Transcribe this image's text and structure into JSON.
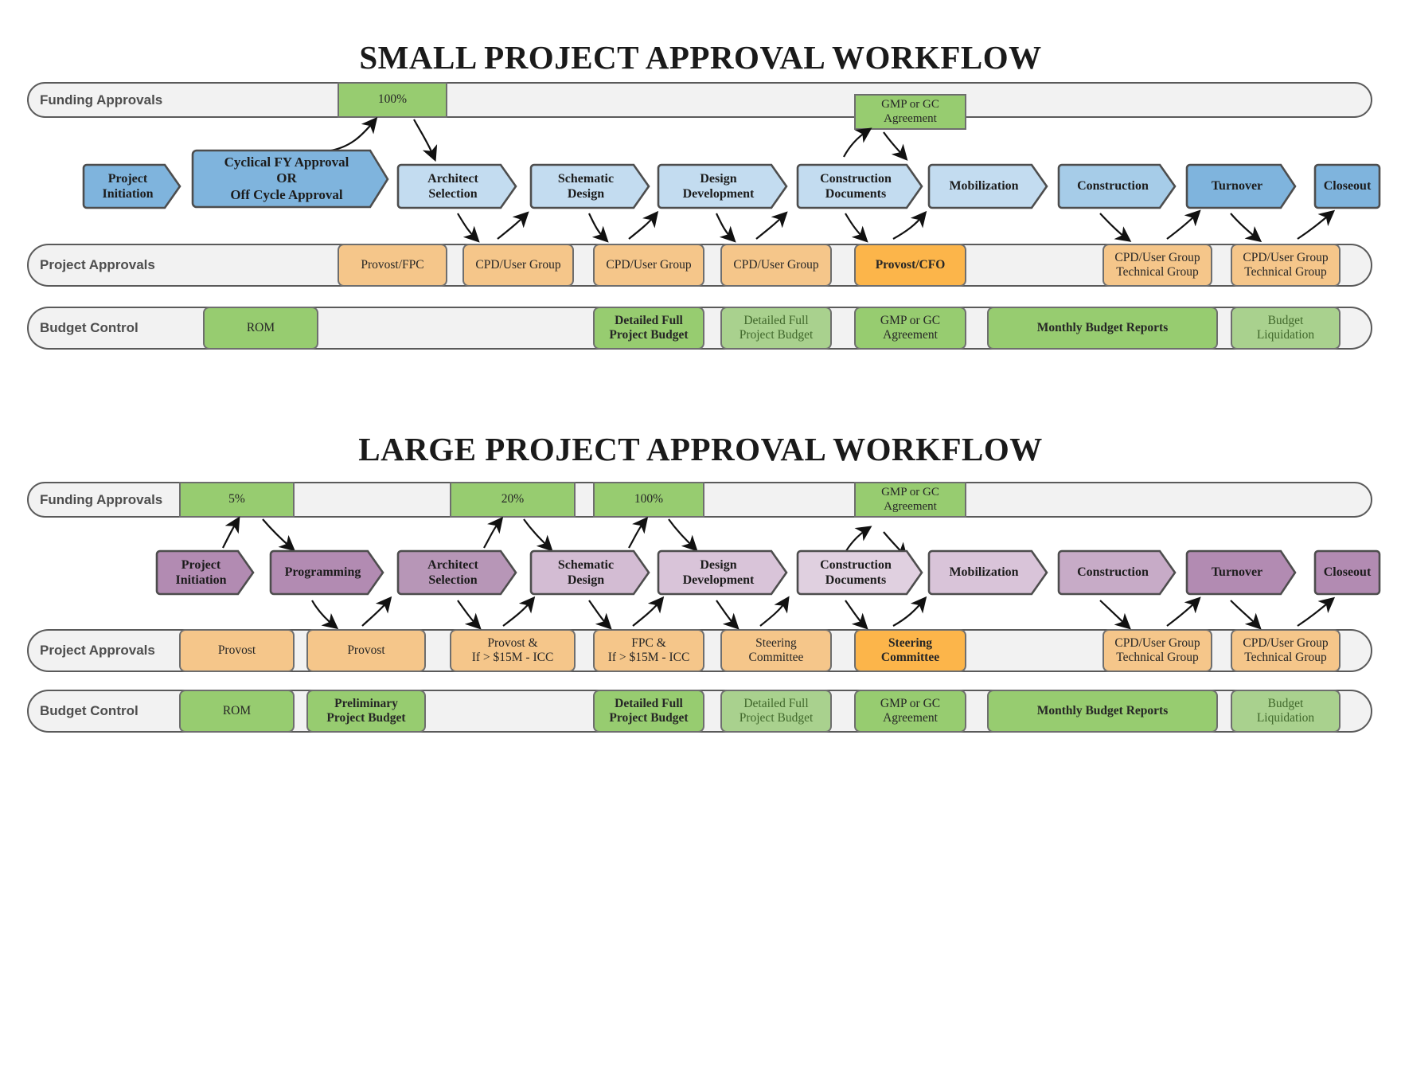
{
  "colors": {
    "green": "#97cc70",
    "green_pale": "#a9d18e",
    "orange": "#f5c68a",
    "orange_dark": "#fcb54a",
    "blue": "#7fb4dd",
    "blue_light": "#c3dcf0",
    "purple": "#b28bb2",
    "purple_light": "#ddcbdd",
    "lane_bg": "#f2f2f2",
    "lane_border": "#5a5a5a"
  },
  "small": {
    "title": "SMALL PROJECT APPROVAL WORKFLOW",
    "lanes": {
      "funding": "Funding Approvals",
      "approvals": "Project Approvals",
      "budget": "Budget Control"
    },
    "funding_items": [
      {
        "label": "100%"
      },
      {
        "label": "GMP or GC\nAgreement"
      }
    ],
    "process": [
      {
        "label": "Project\nInitiation"
      },
      {
        "label": "Cyclical FY Approval\nOR\nOff Cycle Approval"
      },
      {
        "label": "Architect\nSelection"
      },
      {
        "label": "Schematic\nDesign"
      },
      {
        "label": "Design\nDevelopment"
      },
      {
        "label": "Construction\nDocuments"
      },
      {
        "label": "Mobilization"
      },
      {
        "label": "Construction"
      },
      {
        "label": "Turnover"
      },
      {
        "label": "Closeout"
      }
    ],
    "approval_items": [
      {
        "label": "Provost/FPC"
      },
      {
        "label": "CPD/User Group"
      },
      {
        "label": "CPD/User Group"
      },
      {
        "label": "CPD/User Group"
      },
      {
        "label": "Provost/CFO"
      },
      {
        "label": "CPD/User Group\nTechnical Group"
      },
      {
        "label": "CPD/User Group\nTechnical Group"
      }
    ],
    "budget_items": [
      {
        "label": "ROM"
      },
      {
        "label": "Detailed Full\nProject Budget"
      },
      {
        "label": "Detailed Full\nProject Budget"
      },
      {
        "label": "GMP or GC\nAgreement"
      },
      {
        "label": "Monthly Budget Reports"
      },
      {
        "label": "Budget\nLiquidation"
      }
    ]
  },
  "large": {
    "title": "LARGE PROJECT APPROVAL WORKFLOW",
    "lanes": {
      "funding": "Funding Approvals",
      "approvals": "Project Approvals",
      "budget": "Budget Control"
    },
    "funding_items": [
      {
        "label": "5%"
      },
      {
        "label": "20%"
      },
      {
        "label": "100%"
      },
      {
        "label": "GMP or GC\nAgreement"
      }
    ],
    "process": [
      {
        "label": "Project\nInitiation"
      },
      {
        "label": "Programming"
      },
      {
        "label": "Architect\nSelection"
      },
      {
        "label": "Schematic\nDesign"
      },
      {
        "label": "Design\nDevelopment"
      },
      {
        "label": "Construction\nDocuments"
      },
      {
        "label": "Mobilization"
      },
      {
        "label": "Construction"
      },
      {
        "label": "Turnover"
      },
      {
        "label": "Closeout"
      }
    ],
    "approval_items": [
      {
        "label": "Provost"
      },
      {
        "label": "Provost"
      },
      {
        "label": "Provost &\nIf > $15M - ICC"
      },
      {
        "label": "FPC &\nIf > $15M - ICC"
      },
      {
        "label": "Steering\nCommittee"
      },
      {
        "label": "Steering\nCommittee"
      },
      {
        "label": "CPD/User Group\nTechnical Group"
      },
      {
        "label": "CPD/User Group\nTechnical Group"
      }
    ],
    "budget_items": [
      {
        "label": "ROM"
      },
      {
        "label": "Preliminary\nProject Budget"
      },
      {
        "label": "Detailed Full\nProject Budget"
      },
      {
        "label": "Detailed Full\nProject Budget"
      },
      {
        "label": "GMP or GC\nAgreement"
      },
      {
        "label": "Monthly Budget Reports"
      },
      {
        "label": "Budget\nLiquidation"
      }
    ]
  }
}
